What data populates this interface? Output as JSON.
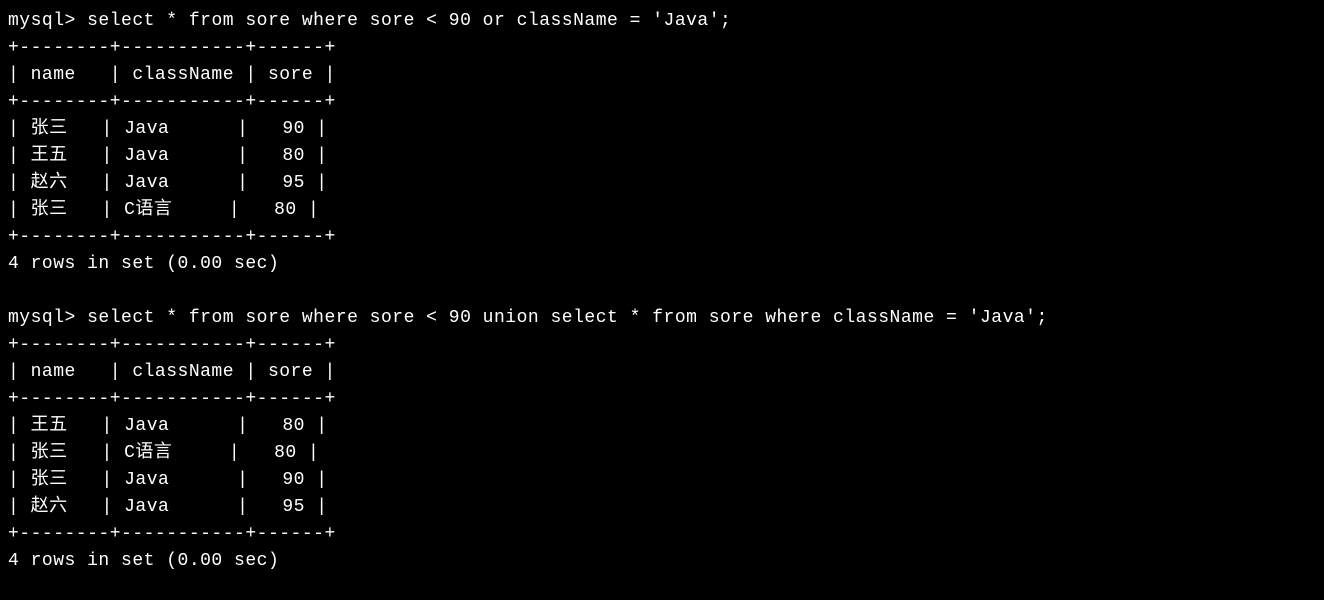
{
  "terminal": {
    "prompt": "mysql> ",
    "query1": "select * from sore where sore < 90 or className = 'Java';",
    "query2": "select * from sore where sore < 90 union select * from sore where className = 'Java';",
    "status": "4 rows in set (0.00 sec)",
    "table1": {
      "border_top": "+--------+-----------+------+",
      "header": "| name   | className | sore |",
      "border_mid": "+--------+-----------+------+",
      "rows": [
        "| 张三   | Java      |   90 |",
        "| 王五   | Java      |   80 |",
        "| 赵六   | Java      |   95 |",
        "| 张三   | C语言     |   80 |"
      ],
      "border_bot": "+--------+-----------+------+"
    },
    "table2": {
      "border_top": "+--------+-----------+------+",
      "header": "| name   | className | sore |",
      "border_mid": "+--------+-----------+------+",
      "rows": [
        "| 王五   | Java      |   80 |",
        "| 张三   | C语言     |   80 |",
        "| 张三   | Java      |   90 |",
        "| 赵六   | Java      |   95 |"
      ],
      "border_bot": "+--------+-----------+------+"
    }
  },
  "chart_data": [
    {
      "type": "table",
      "title": "Query 1 Result",
      "columns": [
        "name",
        "className",
        "sore"
      ],
      "rows": [
        [
          "张三",
          "Java",
          90
        ],
        [
          "王五",
          "Java",
          80
        ],
        [
          "赵六",
          "Java",
          95
        ],
        [
          "张三",
          "C语言",
          80
        ]
      ]
    },
    {
      "type": "table",
      "title": "Query 2 Result",
      "columns": [
        "name",
        "className",
        "sore"
      ],
      "rows": [
        [
          "王五",
          "Java",
          80
        ],
        [
          "张三",
          "C语言",
          80
        ],
        [
          "张三",
          "Java",
          90
        ],
        [
          "赵六",
          "Java",
          95
        ]
      ]
    }
  ]
}
